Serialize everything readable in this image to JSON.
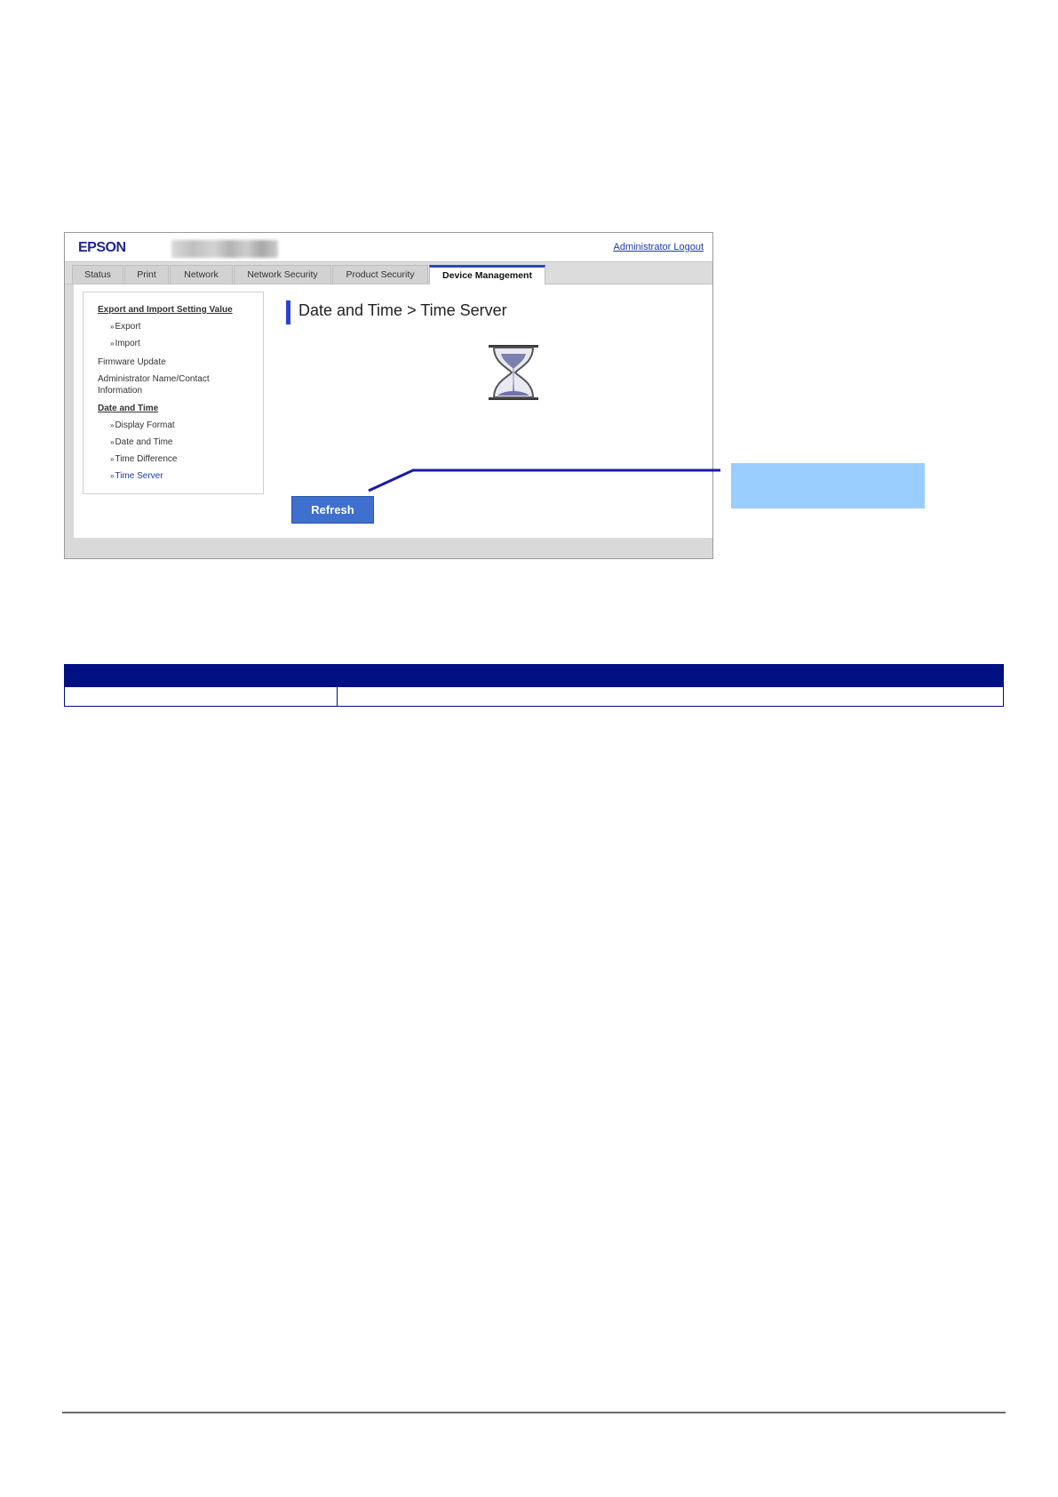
{
  "screenshot": {
    "logo": "EPSON",
    "logout_link": "Administrator Logout",
    "tabs": [
      {
        "label": "Status",
        "active": false
      },
      {
        "label": "Print",
        "active": false
      },
      {
        "label": "Network",
        "active": false
      },
      {
        "label": "Network Security",
        "active": false
      },
      {
        "label": "Product Security",
        "active": false
      },
      {
        "label": "Device Management",
        "active": true
      }
    ],
    "sidebar": {
      "items": [
        {
          "label": "Export and Import Setting Value",
          "style": "heading"
        },
        {
          "label": "Export",
          "style": "sub"
        },
        {
          "label": "Import",
          "style": "sub"
        },
        {
          "label": "Firmware Update",
          "style": "item"
        },
        {
          "label": "Administrator Name/Contact",
          "style": "item"
        },
        {
          "label": "Information",
          "style": "item"
        },
        {
          "label": "Date and Time",
          "style": "heading"
        },
        {
          "label": "Display Format",
          "style": "sub"
        },
        {
          "label": "Date and Time",
          "style": "sub"
        },
        {
          "label": "Time Difference",
          "style": "sub"
        },
        {
          "label": "Time Server",
          "style": "sub-current"
        }
      ],
      "arrow": "»"
    },
    "page_title": "Date and Time > Time Server",
    "refresh_button": "Refresh",
    "colors": {
      "accent": "#2c44c8",
      "button": "#3f6fcf",
      "callout": "#99ccff",
      "callout_line": "#1a1aa6"
    }
  },
  "table": {
    "header": [
      "",
      ""
    ],
    "rows": [
      [
        "",
        ""
      ]
    ],
    "header_color": "#000f82"
  }
}
